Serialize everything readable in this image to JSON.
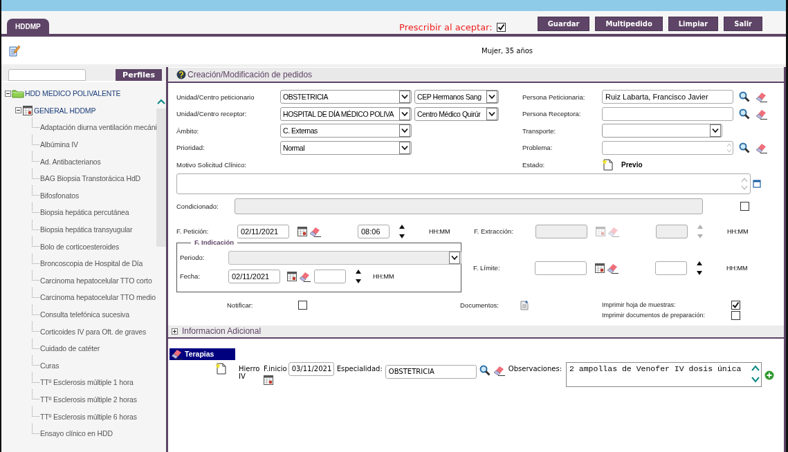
{
  "tabs": [
    {
      "label": "HDDMP",
      "selected": true
    }
  ],
  "prescribe": {
    "label": "Prescribir al aceptar:",
    "checked": true
  },
  "buttons": [
    "Guardar",
    "Multipedido",
    "Limpiar",
    "Salir"
  ],
  "patient": "Mujer, 35 años",
  "sidebar": {
    "profiles_button": "Perfiles",
    "tree": [
      {
        "label": "HDD MEDICO POLIVALENTE",
        "expanded": true,
        "children": [
          {
            "label": "GENERAL HDDMP",
            "expanded": true,
            "children": [
              {
                "label": "Adaptación diurna ventilación mecáni"
              },
              {
                "label": "Albúmina IV"
              },
              {
                "label": "Ad. Antibacterianos"
              },
              {
                "label": "BAG Biopsia Transtorácica HdD"
              },
              {
                "label": "Bifosfonatos"
              },
              {
                "label": "Biopsia hepática percutánea"
              },
              {
                "label": "Biopsia hepática transyugular"
              },
              {
                "label": "Bolo de corticoesteroides"
              },
              {
                "label": "Broncoscopia de Hospital de Día"
              },
              {
                "label": "Carcinoma hepatocelular TTO corto"
              },
              {
                "label": "Carcinoma hepatocelular TTO medio"
              },
              {
                "label": "Consulta telefónica sucesiva"
              },
              {
                "label": "Corticoides IV para Oft. de graves"
              },
              {
                "label": "Cuidado de catéter"
              },
              {
                "label": "Curas"
              },
              {
                "label": "TTº Esclerosis múltiple 1 hora"
              },
              {
                "label": "TTº Esclerosis múltiple 2 horas"
              },
              {
                "label": "TTº Esclerosis múltiple 6 horas"
              },
              {
                "label": "Ensayo clínico en HDD"
              }
            ]
          }
        ]
      }
    ]
  },
  "form": {
    "title": "Creación/Modificación de pedidos",
    "left_fields": [
      {
        "kind": "select-pair",
        "label": "Unidad/Centro peticionario",
        "value": "OBSTETRICIA",
        "centre": "CEP Hermanos Sang"
      },
      {
        "kind": "select-pair",
        "label": "Unidad/Centro receptor:",
        "value": "HOSPITAL DE DÍA MÉDICO POLIVA",
        "centre": "Centro Médico Quirúr"
      },
      {
        "kind": "select",
        "label": "Ámbito:",
        "value": "C. Externas"
      },
      {
        "kind": "select",
        "label": "Prioridad:",
        "value": "Normal"
      },
      {
        "kind": "label",
        "label": "Motivo Solicitud Clínico:"
      }
    ],
    "right_fields": [
      {
        "kind": "lookup",
        "label": "Persona Peticionaria:",
        "value": "Ruiz Labarta, Francisco Javier"
      },
      {
        "kind": "lookup",
        "label": "Persona Receptora:"
      },
      {
        "kind": "select",
        "label": "Transporte:"
      },
      {
        "kind": "lookup-area",
        "label": "Problema:"
      },
      {
        "kind": "status",
        "label": "Estado:",
        "value": "Previo"
      }
    ],
    "conditioned": {
      "label": "Condicionado:",
      "disabled": true,
      "checked": false
    },
    "petition": {
      "label": "F. Petición:",
      "date": "02/11/2021",
      "time": "08:06",
      "time_format": "HH:MM",
      "disabled": false
    },
    "extraction": {
      "label": "F. Extracción:",
      "time_format": "HH:MM",
      "disabled": true
    },
    "indication": {
      "legend": "F. Indicación",
      "period_label": "Periodo:",
      "period_disabled": true,
      "date_label": "Fecha:",
      "date": "02/11/2021",
      "time_format": "HH:MM"
    },
    "limit": {
      "label": "F. Límite:",
      "time_format": "HH:MM",
      "disabled": false
    },
    "notify": {
      "label": "Notificar:",
      "checked": false
    },
    "documents": {
      "label": "Documentos:"
    },
    "print_options": [
      {
        "label": "Imprimir hoja de muestras:",
        "checked": true
      },
      {
        "label": "Imprimir documentos de preparación:",
        "checked": false
      }
    ]
  },
  "additional": {
    "label": "Informacion Adicional",
    "expanded": false
  },
  "therapies": {
    "tab": "Terapias",
    "rows": [
      {
        "name": "Hierro IV",
        "start_label": "F.inicio",
        "start": "03/11/2021",
        "specialty_label": "Especialidad:",
        "specialty": "OBSTETRICIA",
        "notes_label": "Observaciones:",
        "notes": "2 ampollas de Venofer IV dosis única"
      }
    ]
  }
}
